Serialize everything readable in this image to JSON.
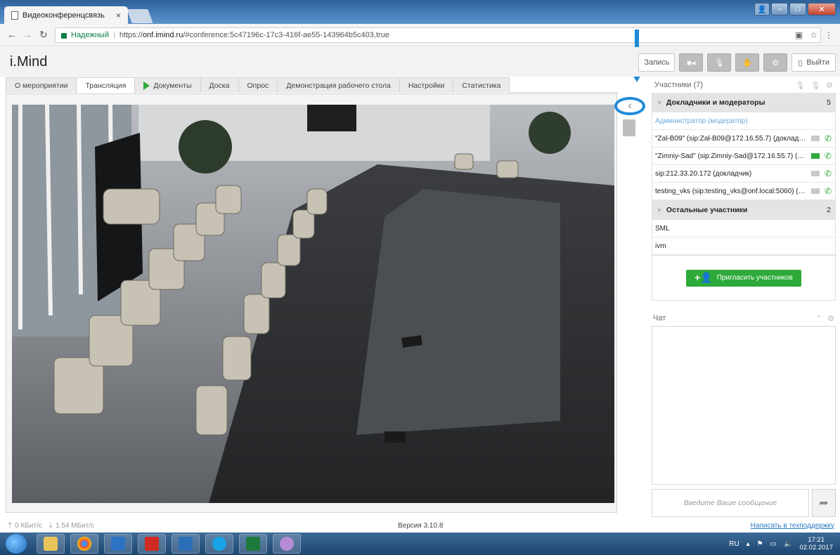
{
  "browser": {
    "tab_title": "Видеоконференцсвязь",
    "tab_close": "×",
    "secure_label": "Надежный",
    "url_prefix": "https://",
    "url_host": "onf.imind.ru",
    "url_path": "/#conference:5c47196c-17c3-416f-ae55-143964b5c403,true"
  },
  "app": {
    "logo": "i.Mind",
    "header_buttons": {
      "record": "Запись",
      "exit": "Выйти"
    },
    "tabs": [
      {
        "label": "О мероприятии"
      },
      {
        "label": "Трансляция"
      },
      {
        "label": "Документы"
      },
      {
        "label": "Доска"
      },
      {
        "label": "Опрос"
      },
      {
        "label": "Демонстрация рабочего стола"
      },
      {
        "label": "Настройки"
      },
      {
        "label": "Статистика"
      }
    ]
  },
  "participants": {
    "title": "Участники (7)",
    "groups": [
      {
        "name": "Докладчики и модераторы",
        "count": "5",
        "items": [
          {
            "name": "Администратор (модератор)"
          },
          {
            "name": "\"Zal-B09\" (sip:Zal-B09@172.16.55.7) (докладчик)"
          },
          {
            "name": "\"Zimniy-Sad\" (sip:Zimniy-Sad@172.16.55.7) (до..."
          },
          {
            "name": "sip:212.33.20.172 (докладчик)"
          },
          {
            "name": "testing_vks (sip:testing_vks@onf.local:5060) (до..."
          }
        ]
      },
      {
        "name": "Остальные участники",
        "count": "2",
        "items": [
          {
            "name": "SML"
          },
          {
            "name": "ivm"
          }
        ]
      }
    ],
    "invite_label": "Пригласить участников"
  },
  "chat": {
    "title": "Чат",
    "placeholder": "Введите Ваше сообщение"
  },
  "status": {
    "upload": "0 КБит/с",
    "download": "1.54 МБит/с",
    "version": "Версия 3.10.8",
    "support_link": "Написать в техподдержку"
  },
  "taskbar": {
    "lang": "RU",
    "time": "17:21",
    "date": "02.02.2017"
  },
  "colors": {
    "accent_green": "#2eaa3a",
    "annotation_blue": "#1f8ad9",
    "link_blue": "#2a7ac0"
  }
}
